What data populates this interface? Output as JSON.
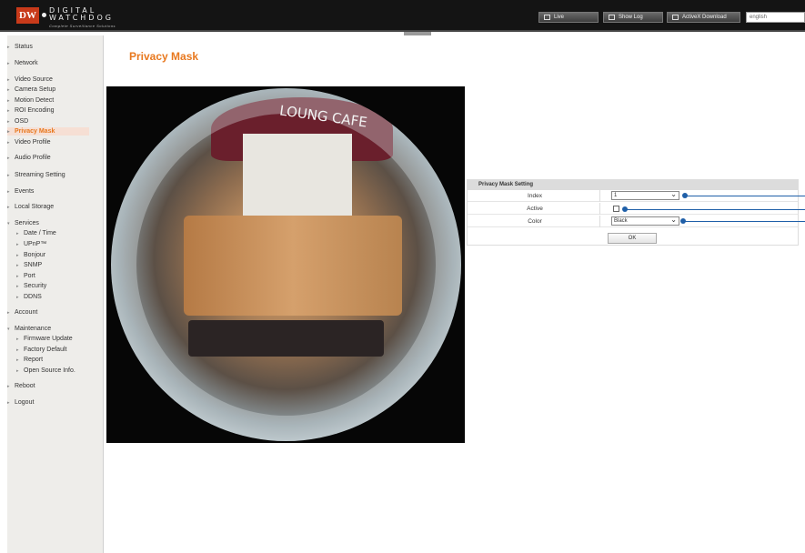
{
  "header": {
    "logo_mark": "DW",
    "logo_line1": "DIGITAL",
    "logo_line2": "WATCHDOG",
    "logo_tagline": "Complete Surveillance Solutions",
    "buttons": {
      "live": "Live",
      "show_log": "Show Log",
      "activex": "ActiveX Download"
    },
    "language": "english"
  },
  "sidebar": {
    "items": [
      {
        "label": "Status"
      },
      {
        "label": "Network"
      },
      {
        "label": "Video Source"
      },
      {
        "label": "Camera Setup"
      },
      {
        "label": "Motion Detect"
      },
      {
        "label": "ROI Encoding"
      },
      {
        "label": "OSD"
      },
      {
        "label": "Privacy Mask",
        "active": true
      },
      {
        "label": "Video Profile"
      },
      {
        "label": "Audio Profile"
      },
      {
        "label": "Streaming Setting"
      },
      {
        "label": "Events"
      },
      {
        "label": "Local Storage"
      },
      {
        "label": "Services"
      },
      {
        "label": "Date / Time"
      },
      {
        "label": "UPnP™"
      },
      {
        "label": "Bonjour"
      },
      {
        "label": "SNMP"
      },
      {
        "label": "Port"
      },
      {
        "label": "Security"
      },
      {
        "label": "DDNS"
      },
      {
        "label": "Account"
      },
      {
        "label": "Maintenance"
      },
      {
        "label": "Firmware Update"
      },
      {
        "label": "Factory Default"
      },
      {
        "label": "Report"
      },
      {
        "label": "Open Source Info."
      },
      {
        "label": "Reboot"
      },
      {
        "label": "Logout"
      }
    ]
  },
  "main": {
    "title": "Privacy Mask",
    "camera_sign": "LOUNG CAFE",
    "settings": {
      "heading": "Privacy Mask Setting",
      "index_label": "Index",
      "index_value": "1",
      "active_label": "Active",
      "active_checked": false,
      "color_label": "Color",
      "color_value": "Black",
      "ok_label": "OK"
    }
  },
  "colors": {
    "accent": "#e8781e",
    "callout": "#1f5fa8",
    "header_bg": "#141414",
    "sidebar_bg": "#eeedea"
  }
}
